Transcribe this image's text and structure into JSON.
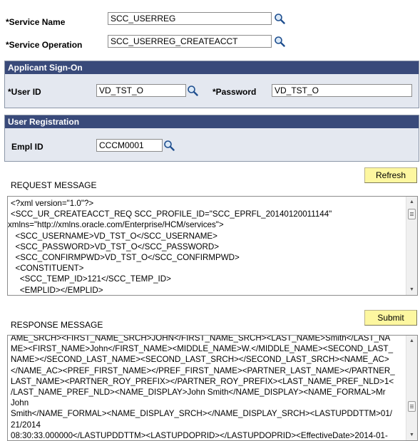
{
  "service": {
    "service_name_label": "*Service Name",
    "service_name_value": "SCC_USERREG",
    "service_operation_label": "*Service Operation",
    "service_operation_value": "SCC_USERREG_CREATEACCT"
  },
  "applicant_signon": {
    "header": "Applicant Sign-On",
    "user_id_label": "*User ID",
    "user_id_value": "VD_TST_O",
    "password_label": "*Password",
    "password_value": "VD_TST_O"
  },
  "user_registration": {
    "header": "User Registration",
    "empl_id_label": "Empl ID",
    "empl_id_value": "CCCM0001"
  },
  "request": {
    "label": "REQUEST MESSAGE",
    "button": "Refresh",
    "lines": [
      "<?xml version=\"1.0\"?>",
      "<SCC_UR_CREATEACCT_REQ SCC_PROFILE_ID=\"SCC_EPRFL_20140120011144\"",
      "xmlns=\"http://xmlns.oracle.com/Enterprise/HCM/services\">",
      "  <SCC_USERNAME>VD_TST_O</SCC_USERNAME>",
      "  <SCC_PASSWORD>VD_TST_O</SCC_PASSWORD>",
      "  <SCC_CONFIRMPWD>VD_TST_O</SCC_CONFIRMPWD>",
      "  <CONSTITUENT>",
      "    <SCC_TEMP_ID>121</SCC_TEMP_ID>",
      "    <EMPLID></EMPLID>"
    ]
  },
  "response": {
    "label": "RESPONSE MESSAGE",
    "button": "Submit",
    "lines": [
      "AME_SRCH><FIRST_NAME_SRCH>JOHN</FIRST_NAME_SRCH><LAST_NAME>Smith</LAST_NA",
      "ME><FIRST_NAME>John</FIRST_NAME><MIDDLE_NAME>W.</MIDDLE_NAME><SECOND_LAST_",
      "NAME></SECOND_LAST_NAME><SECOND_LAST_SRCH></SECOND_LAST_SRCH><NAME_AC>",
      "</NAME_AC><PREF_FIRST_NAME></PREF_FIRST_NAME><PARTNER_LAST_NAME></PARTNER_",
      "LAST_NAME><PARTNER_ROY_PREFIX></PARTNER_ROY_PREFIX><LAST_NAME_PREF_NLD>1<",
      "/LAST_NAME_PREF_NLD><NAME_DISPLAY>John Smith</NAME_DISPLAY><NAME_FORMAL>Mr",
      "John",
      "Smith</NAME_FORMAL><NAME_DISPLAY_SRCH></NAME_DISPLAY_SRCH><LASTUPDDTTM>01/",
      "21/2014",
      "08:30:33.000000</LASTUPDDTTM><LASTUPDOPRID></LASTUPDOPRID><EffectiveDate>2014-01-"
    ]
  },
  "icons": {
    "lookup": "magnifier-icon"
  }
}
